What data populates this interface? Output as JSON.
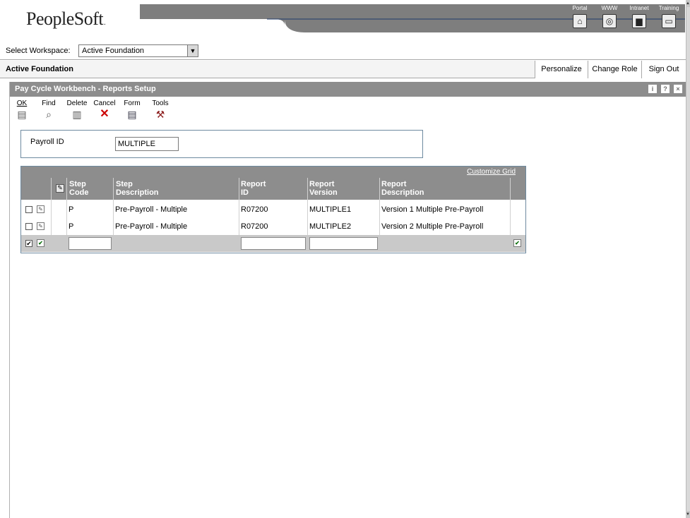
{
  "banner": {
    "logo_text": "PeopleSoft",
    "logo_mark": ".",
    "links": [
      {
        "label": "Portal",
        "icon": "home-icon",
        "glyph": "⌂"
      },
      {
        "label": "WWW",
        "icon": "globe-icon",
        "glyph": "◎"
      },
      {
        "label": "Intranet",
        "icon": "book-icon",
        "glyph": "▆"
      },
      {
        "label": "Training",
        "icon": "computer-icon",
        "glyph": "▭"
      }
    ]
  },
  "workspace": {
    "label": "Select Workspace:",
    "selected": "Active Foundation"
  },
  "app_bar": {
    "title": "Active Foundation",
    "personalize": "Personalize",
    "change_role": "Change Role",
    "sign_out": "Sign Out"
  },
  "form": {
    "title": "Pay Cycle Workbench - Reports Setup",
    "title_icons": [
      "i",
      "?",
      "×"
    ],
    "toolbar": {
      "ok": {
        "label": "OK",
        "icon": "save-icon"
      },
      "find": {
        "label": "Find",
        "icon": "find-icon"
      },
      "delete": {
        "label": "Delete",
        "icon": "trash-icon"
      },
      "cancel": {
        "label": "Cancel",
        "icon": "cancel-x-icon"
      },
      "form": {
        "label": "Form",
        "icon": "form-exit-icon"
      },
      "tools": {
        "label": "Tools",
        "icon": "tools-icon"
      }
    },
    "payroll_label": "Payroll ID",
    "payroll_value": "MULTIPLE"
  },
  "grid": {
    "customize": "Customize Grid",
    "columns": [
      {
        "line1": "Step",
        "line2": "Code"
      },
      {
        "line1": "Step",
        "line2": "Description"
      },
      {
        "line1": "Report",
        "line2": "ID"
      },
      {
        "line1": "Report",
        "line2": "Version"
      },
      {
        "line1": "Report",
        "line2": "Description"
      }
    ],
    "rows": [
      {
        "step_code": "P",
        "step_desc": "Pre-Payroll - Multiple",
        "report_id": "R07200",
        "report_version": "MULTIPLE1",
        "report_desc": "Version 1 Multiple Pre-Payroll"
      },
      {
        "step_code": "P",
        "step_desc": "Pre-Payroll - Multiple",
        "report_id": "R07200",
        "report_version": "MULTIPLE2",
        "report_desc": "Version 2 Multiple Pre-Payroll"
      }
    ]
  },
  "colors": {
    "title_bar": "#8d8d8d",
    "banner_band": "#7e7e7e",
    "border_blue": "#6e8aa0",
    "cancel_red": "#cc0000"
  }
}
